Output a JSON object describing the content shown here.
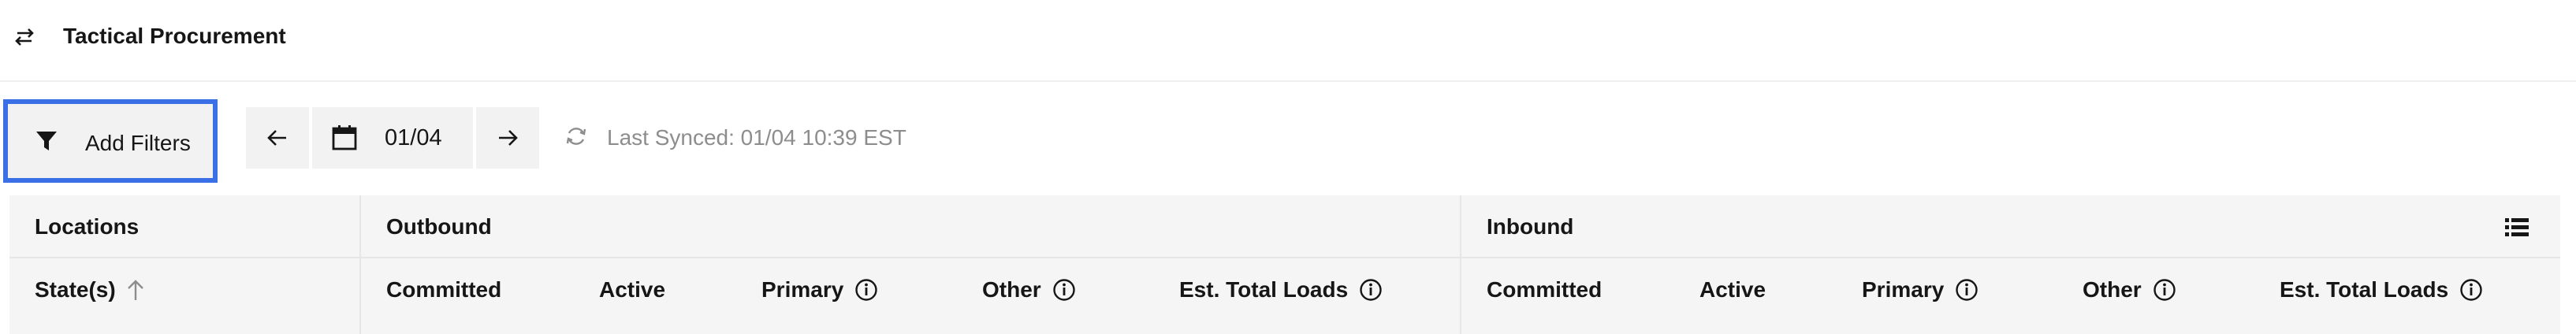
{
  "header": {
    "title": "Tactical Procurement",
    "icon": "swap-arrows-icon"
  },
  "toolbar": {
    "filters_label": "Add Filters",
    "filters_icon": "filter-icon",
    "prev_icon": "arrow-left-icon",
    "next_icon": "arrow-right-icon",
    "date_icon": "calendar-icon",
    "date_value": "01/04",
    "sync_icon": "sync-icon",
    "last_synced": "Last Synced: 01/04 10:39 EST",
    "focus_color": "#3a6fe5"
  },
  "table": {
    "groups": {
      "locations": "Locations",
      "outbound": "Outbound",
      "inbound": "Inbound"
    },
    "columns": {
      "states": "State(s)",
      "out_committed": "Committed",
      "out_active": "Active",
      "out_primary": "Primary",
      "out_other": "Other",
      "out_est_total": "Est. Total Loads",
      "in_committed": "Committed",
      "in_active": "Active",
      "in_primary": "Primary",
      "in_other": "Other",
      "in_est_total": "Est. Total Loads"
    },
    "sort": "ascending",
    "view_toggle_icon": "list-view-icon"
  }
}
